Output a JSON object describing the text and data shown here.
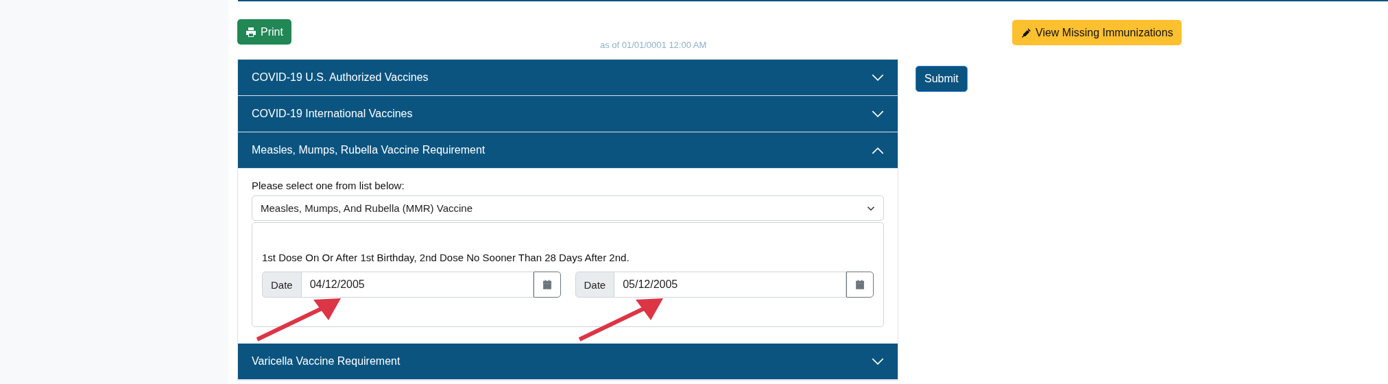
{
  "print_button": {
    "label": "Print"
  },
  "as_of": "as of 01/01/0001 12:00 AM",
  "missing_button": {
    "label": "View Missing Immunizations"
  },
  "submit_button": {
    "label": "Submit"
  },
  "accordion": [
    {
      "title": "COVID-19 U.S. Authorized Vaccines",
      "expanded": false
    },
    {
      "title": "COVID-19 International Vaccines",
      "expanded": false
    },
    {
      "title": "Measles, Mumps, Rubella Vaccine Requirement",
      "expanded": true,
      "body": {
        "prompt": "Please select one from list below:",
        "select_value": "Measles, Mumps, And Rubella (MMR) Vaccine",
        "rule": "1st Dose On Or After 1st Birthday, 2nd Dose No Sooner Than 28 Days After 2nd.",
        "date_fields": [
          {
            "label": "Date",
            "value": "04/12/2005"
          },
          {
            "label": "Date",
            "value": "05/12/2005"
          }
        ]
      }
    },
    {
      "title": "Varicella Vaccine Requirement",
      "expanded": false
    }
  ]
}
